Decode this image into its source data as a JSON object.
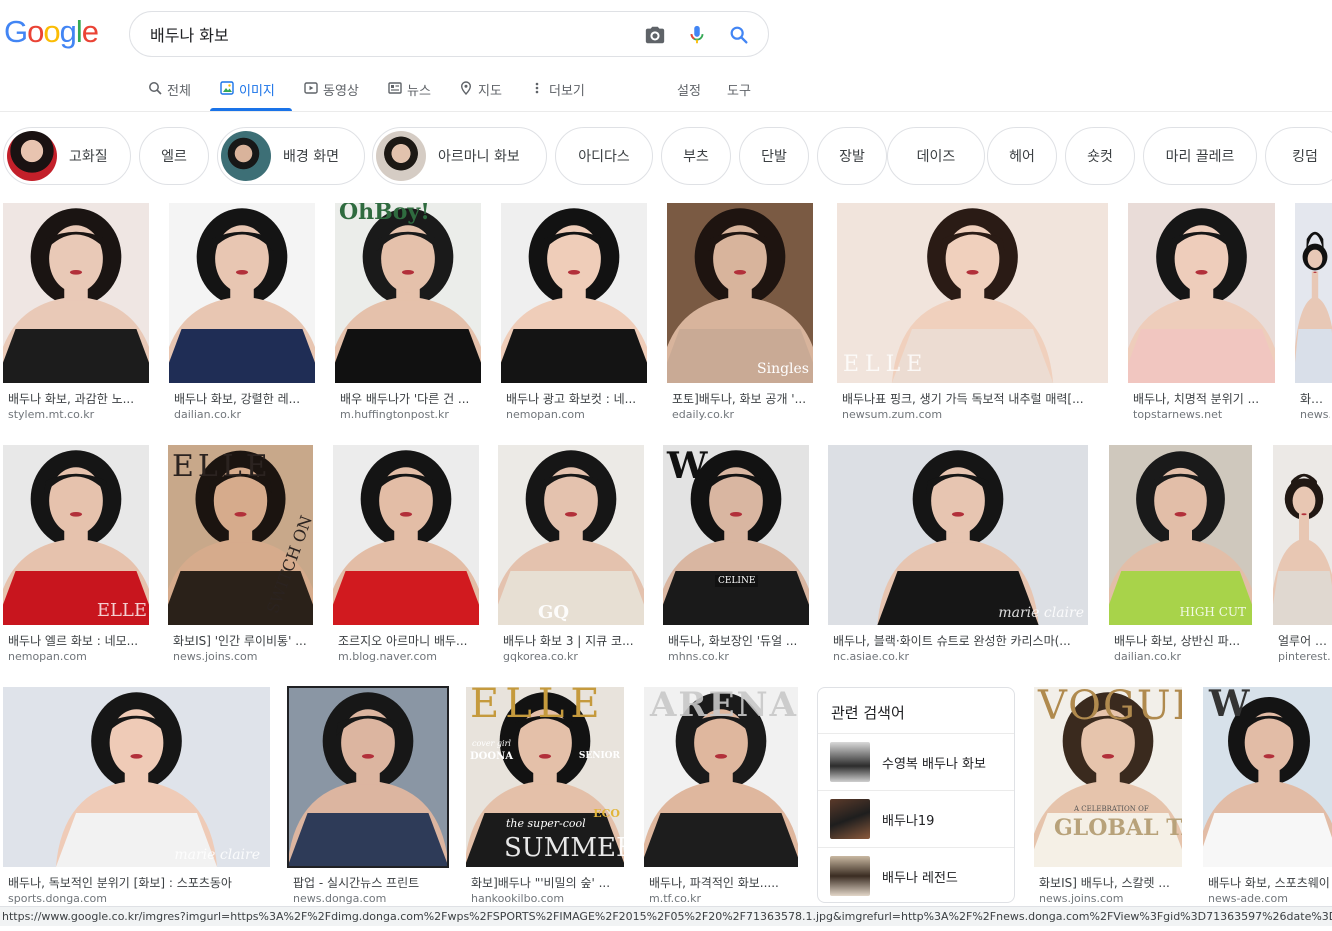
{
  "logo": {
    "letters": [
      "G",
      "o",
      "o",
      "g",
      "l",
      "e"
    ],
    "colors": [
      "#4285f4",
      "#ea4335",
      "#fbbc05",
      "#4285f4",
      "#34a853",
      "#ea4335"
    ]
  },
  "search": {
    "value": "배두나 화보",
    "camera_icon": "camera-icon",
    "mic_icon": "mic-icon",
    "search_icon": "search-icon"
  },
  "tabs": [
    {
      "label": "전체",
      "icon": "search-icon"
    },
    {
      "label": "이미지",
      "icon": "image-icon",
      "active": true
    },
    {
      "label": "동영상",
      "icon": "video-icon"
    },
    {
      "label": "뉴스",
      "icon": "news-icon"
    },
    {
      "label": "지도",
      "icon": "map-pin-icon"
    },
    {
      "label": "더보기",
      "icon": "more-vert-icon"
    }
  ],
  "tools": {
    "settings": "설정",
    "tools": "도구"
  },
  "chips": [
    {
      "label": "고화질",
      "has_thumb": true
    },
    {
      "label": "엘르",
      "has_thumb": false
    },
    {
      "label": "배경 화면",
      "has_thumb": true
    },
    {
      "label": "아르마니 화보",
      "has_thumb": true
    },
    {
      "label": "아디다스",
      "has_thumb": false
    },
    {
      "label": "부츠",
      "has_thumb": false
    },
    {
      "label": "단발",
      "has_thumb": false
    },
    {
      "label": "장발",
      "has_thumb": false
    },
    {
      "label": "데이즈",
      "has_thumb": false
    },
    {
      "label": "헤어",
      "has_thumb": false
    },
    {
      "label": "숏컷",
      "has_thumb": false
    },
    {
      "label": "마리 끌레르",
      "has_thumb": false
    },
    {
      "label": "킹덤",
      "has_thumb": false
    }
  ],
  "results": [
    {
      "caption": "배두나 화보, 과감한 노...",
      "source": "stylem.mt.co.kr",
      "colors": {
        "bg": "#efe6e3",
        "hair": "#1a1412",
        "body": "#e9c9b7",
        "cloth": "#1c1c1c"
      }
    },
    {
      "caption": "배두나 화보, 강렬한 레...",
      "source": "dailian.co.kr",
      "colors": {
        "bg": "#f4f4f4",
        "hair": "#141414",
        "body": "#e8c6b2",
        "cloth": "#1f2d55"
      }
    },
    {
      "caption": "배우 배두나가 '다른 건 ...",
      "source": "m.huffingtonpost.kr",
      "colors": {
        "bg": "#ebedea",
        "hair": "#1a1a1a",
        "body": "#e5c1ab",
        "cloth": "#111111"
      }
    },
    {
      "caption": "배두나 광고 화보컷 : 네...",
      "source": "nemopan.com",
      "colors": {
        "bg": "#efefef",
        "hair": "#121212",
        "body": "#efcdb9",
        "cloth": "#141414"
      }
    },
    {
      "caption": "포토]배두나, 화보 공개 '...",
      "source": "edaily.co.kr",
      "colors": {
        "bg": "#7a5a43",
        "hair": "#1e1410",
        "body": "#d8b49c",
        "cloth": "#c9aa95"
      }
    },
    {
      "caption": "배두나표 핑크, 생기 가득 독보적 내추럴 매력[...",
      "source": "newsum.zum.com",
      "colors": {
        "bg": "#f1e4dc",
        "hair": "#2a1b15",
        "body": "#f0d0bd",
        "cloth": "#ecdcd2"
      }
    },
    {
      "caption": "배두나, 치명적 분위기 ...",
      "source": "topstarnews.net",
      "colors": {
        "bg": "#e9dcd8",
        "hair": "#161616",
        "body": "#eecdbb",
        "cloth": "#f1c6c0"
      }
    },
    {
      "caption": "화보IS",
      "source": "news.j",
      "colors": {
        "bg": "#e4e7ee",
        "hair": "#111111",
        "body": "#e8c8b6",
        "cloth": "#d9dfe9"
      }
    },
    {
      "caption": "배두나 엘르 화보 : 네모...",
      "source": "nemopan.com",
      "colors": {
        "bg": "#e8e8e8",
        "hair": "#151515",
        "body": "#e6c2ad",
        "cloth": "#c8151e"
      }
    },
    {
      "caption": "화보IS] '인간 루이비통' ...",
      "source": "news.joins.com",
      "colors": {
        "bg": "#c8a88a",
        "hair": "#1b1410",
        "body": "#d6ab8c",
        "cloth": "#2a2119"
      }
    },
    {
      "caption": "조르지오 아르마니 배두...",
      "source": "m.blog.naver.com",
      "colors": {
        "bg": "#ececec",
        "hair": "#141414",
        "body": "#e3bda6",
        "cloth": "#d11a1f"
      }
    },
    {
      "caption": "배두나 화보 3 | 지큐 코...",
      "source": "gqkorea.co.kr",
      "colors": {
        "bg": "#eceae6",
        "hair": "#161616",
        "body": "#e4c2ae",
        "cloth": "#e7dfd3"
      }
    },
    {
      "caption": "배두나, 화보장인 '듀얼 ...",
      "source": "mhns.co.kr",
      "colors": {
        "bg": "#e3e3e3",
        "hair": "#121212",
        "body": "#d9b6a1",
        "cloth": "#1a1a1a"
      }
    },
    {
      "caption": "배두나, 블랙·화이트 슈트로 완성한 카리스마(...",
      "source": "nc.asiae.co.kr",
      "colors": {
        "bg": "#dcdfe4",
        "hair": "#151515",
        "body": "#e7c5b1",
        "cloth": "#161616"
      }
    },
    {
      "caption": "배두나 화보, 상반신 파...",
      "source": "dailian.co.kr",
      "colors": {
        "bg": "#cfc8bd",
        "hair": "#1a1a1a",
        "body": "#e2bea8",
        "cloth": "#a8d34a"
      }
    },
    {
      "caption": "얼루어 #배",
      "source": "pinterest.c",
      "colors": {
        "bg": "#ece9e6",
        "hair": "#211813",
        "body": "#e8c7b3",
        "cloth": "#e0d8d0"
      }
    },
    {
      "caption": "배두나, 독보적인 분위기 [화보] : 스포츠동아",
      "source": "sports.donga.com",
      "colors": {
        "bg": "#dfe3ea",
        "hair": "#161616",
        "body": "#efcbb7",
        "cloth": "#f2f2f2"
      }
    },
    {
      "caption": "팝업 - 실시간뉴스 프린트",
      "source": "news.donga.com",
      "colors": {
        "bg": "#8a96a4",
        "hair": "#171717",
        "body": "#dcb5a0",
        "cloth": "#2e3b58"
      }
    },
    {
      "caption": "화보]배두나 \"'비밀의 숲' ...",
      "source": "hankookilbo.com",
      "colors": {
        "bg": "#e8e3dc",
        "hair": "#121212",
        "body": "#e4c0a9",
        "cloth": "#1b1b1b"
      }
    },
    {
      "caption": "배두나, 파격적인 화보.....",
      "source": "m.tf.co.kr",
      "colors": {
        "bg": "#f1f1f1",
        "hair": "#1a1a1a",
        "body": "#dfb79e",
        "cloth": "#1d1d1d"
      }
    },
    {
      "caption": "화보IS] 배두나, 스칼렛 ...",
      "source": "news.joins.com",
      "colors": {
        "bg": "#f2efe9",
        "hair": "#3a2a1e",
        "body": "#e6c4ac",
        "cloth": "#f5f0e6"
      }
    },
    {
      "caption": "배두나 화보, 스포츠웨이",
      "source": "news-ade.com",
      "colors": {
        "bg": "#d7e1ea",
        "hair": "#141414",
        "body": "#e2bca6",
        "cloth": "#f7f7f7"
      }
    }
  ],
  "magazine_marks": {
    "r2": "OhBoy!",
    "r5": "Singles",
    "r6": "ELLE",
    "r9": "ELLE",
    "r10": "ELLE",
    "r10b": "SWITCH ON",
    "r13": "W",
    "r13b": "CELINE",
    "r14": "marie claire",
    "r15": "HIGH CUT",
    "r12": "GQ",
    "r17": "marie claire",
    "r19": "ELLE",
    "r19a": "DOONA",
    "r19b": "the super-cool",
    "r19c": "SUMMER",
    "r19d": "SENIOR",
    "r19e": "ECO",
    "r19f": "cover girl",
    "r20": "ARENA",
    "r21": "VOGUE",
    "r21b": "GLOBAL TALENT",
    "r21c": "A CELEBRATION OF",
    "r22": "W"
  },
  "related": {
    "title": "관련 검색어",
    "items": [
      {
        "label": "수영복 배두나 화보"
      },
      {
        "label": "배두나19"
      },
      {
        "label": "배두나 레전드"
      }
    ]
  },
  "status_bar": {
    "url": "https://www.google.co.kr/imgres?imgurl=https%3A%2F%2Fdimg.donga.com%2Fwps%2FSPORTS%2FIMAGE%2F2015%2F05%2F20%2F71363578.1.jpg&imgrefurl=http%3A%2F%2Fnews.donga.com%2FView%3Fgid%3D71363597%26date%3D2015052"
  }
}
